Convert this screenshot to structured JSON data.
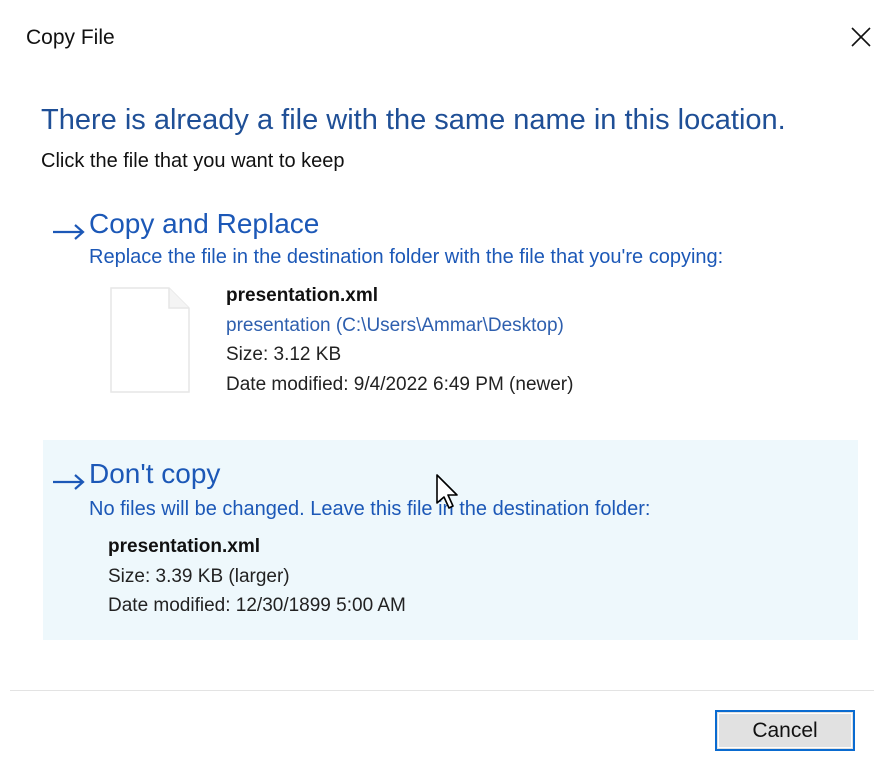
{
  "window": {
    "title": "Copy File"
  },
  "header": {
    "headline": "There is already a file with the same name in this location.",
    "instruction": "Click the file that you want to keep"
  },
  "options": {
    "replace": {
      "title": "Copy and Replace",
      "description": "Replace the file in the destination folder with the file that you're copying:",
      "file": {
        "name": "presentation.xml",
        "location": "presentation (C:\\Users\\Ammar\\Desktop)",
        "size": "Size: 3.12 KB",
        "date_modified": "Date modified: 9/4/2022 6:49 PM (newer)"
      }
    },
    "skip": {
      "title": "Don't copy",
      "description": "No files will be changed. Leave this file in the destination folder:",
      "file": {
        "name": "presentation.xml",
        "size": "Size: 3.39 KB (larger)",
        "date_modified": "Date modified: 12/30/1899 5:00 AM"
      }
    }
  },
  "footer": {
    "cancel_label": "Cancel"
  },
  "icons": {
    "close": "close-icon",
    "arrow": "arrow-right-icon",
    "file": "file-icon",
    "cursor": "mouse-pointer-icon"
  },
  "colors": {
    "headline": "#1f4f96",
    "link": "#1c58b7",
    "hover_background": "#eef8fc",
    "button_focus_border": "#0a6bd0"
  }
}
